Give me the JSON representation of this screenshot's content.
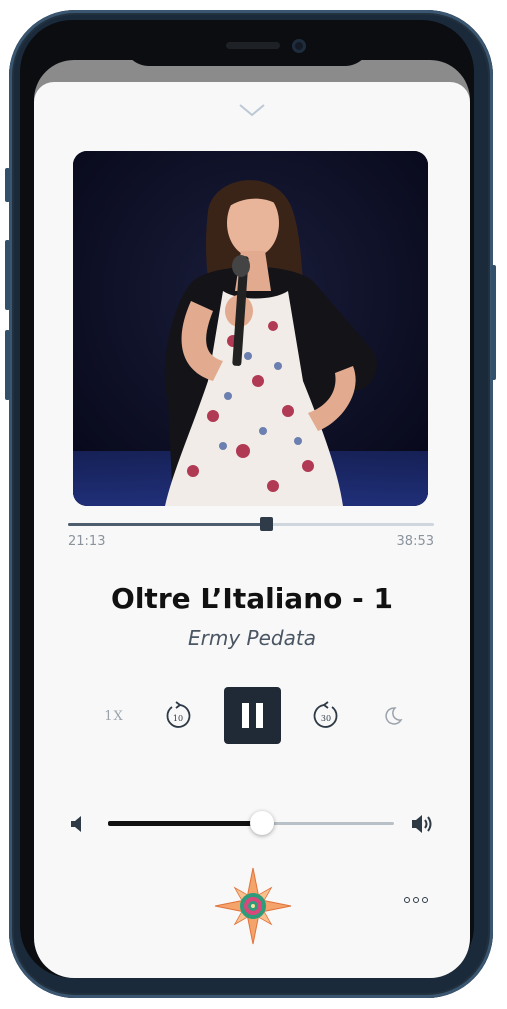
{
  "player": {
    "collapse_icon": "chevron-down-icon",
    "elapsed": "21:13",
    "duration": "38:53",
    "progress": 0.54,
    "title": "Oltre L’Italiano - 1",
    "author": "Ermy Pedata",
    "speed_label": "1X",
    "skip_back_seconds": "10",
    "skip_forward_seconds": "30",
    "sleep_icon": "moon-icon",
    "play_state_icon": "pause-icon",
    "volume_level": 0.54,
    "mute_icon": "speaker-low-icon",
    "volume_max_icon": "speaker-high-icon",
    "logo_icon": "compass-star-logo",
    "more_icon": "more-dots-icon"
  },
  "colors": {
    "background": "#f8f8f8",
    "primary_dark": "#1f2a36",
    "muted": "#9aa3ab",
    "logo_orange": "#f0904a",
    "logo_green": "#2e9c7a",
    "logo_pink": "#d9487a"
  }
}
